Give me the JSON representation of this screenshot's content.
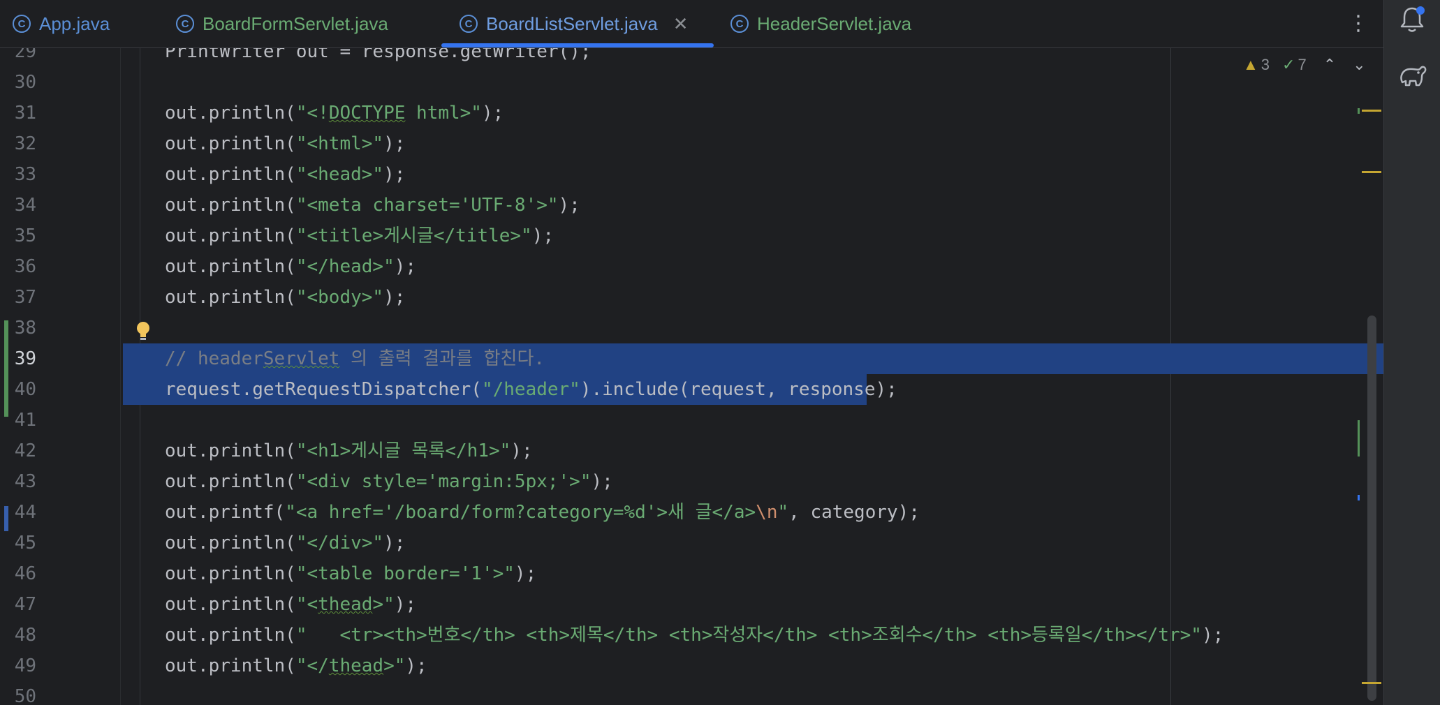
{
  "tabs": [
    {
      "label": "App.java",
      "icon": "class-c-icon"
    },
    {
      "label": "BoardFormServlet.java",
      "icon": "class-c-icon"
    },
    {
      "label": "BoardListServlet.java",
      "icon": "class-c-icon",
      "active": true
    },
    {
      "label": "HeaderServlet.java",
      "icon": "class-c-icon"
    }
  ],
  "inspection": {
    "warnings": "3",
    "checks": "7"
  },
  "colors": {
    "editor_bg": "#1e1f22",
    "selection": "#214283",
    "string": "#6aab73",
    "keyword_escape": "#cf8e6d",
    "comment": "#7a7e85",
    "accent": "#3574f0"
  },
  "lines": [
    {
      "n": "29",
      "tokens": [
        {
          "t": "PrintWriter out = response.getWriter();"
        }
      ]
    },
    {
      "n": "30",
      "tokens": []
    },
    {
      "n": "31",
      "tokens": [
        {
          "t": "out.println("
        },
        {
          "t": "\"<!",
          "c": "str"
        },
        {
          "t": "DOCTYPE",
          "c": "str wavy"
        },
        {
          "t": " html>\"",
          "c": "str"
        },
        {
          "t": ");"
        }
      ]
    },
    {
      "n": "32",
      "tokens": [
        {
          "t": "out.println("
        },
        {
          "t": "\"<html>\"",
          "c": "str"
        },
        {
          "t": ");"
        }
      ]
    },
    {
      "n": "33",
      "tokens": [
        {
          "t": "out.println("
        },
        {
          "t": "\"<head>\"",
          "c": "str"
        },
        {
          "t": ");"
        }
      ]
    },
    {
      "n": "34",
      "tokens": [
        {
          "t": "out.println("
        },
        {
          "t": "\"<meta charset='UTF-8'>\"",
          "c": "str"
        },
        {
          "t": ");"
        }
      ]
    },
    {
      "n": "35",
      "tokens": [
        {
          "t": "out.println("
        },
        {
          "t": "\"<title>게시글</title>\"",
          "c": "str"
        },
        {
          "t": ");"
        }
      ]
    },
    {
      "n": "36",
      "tokens": [
        {
          "t": "out.println("
        },
        {
          "t": "\"</head>\"",
          "c": "str"
        },
        {
          "t": ");"
        }
      ]
    },
    {
      "n": "37",
      "tokens": [
        {
          "t": "out.println("
        },
        {
          "t": "\"<body>\"",
          "c": "str"
        },
        {
          "t": ");"
        }
      ]
    },
    {
      "n": "38",
      "tokens": []
    },
    {
      "n": "39",
      "tokens": [
        {
          "t": "// header",
          "c": "cmt"
        },
        {
          "t": "Servlet",
          "c": "cmt wavy"
        },
        {
          "t": " 의 출력 결과를 합친다.",
          "c": "cmt"
        }
      ]
    },
    {
      "n": "40",
      "tokens": [
        {
          "t": "request.getRequestDispatcher("
        },
        {
          "t": "\"/header\"",
          "c": "str"
        },
        {
          "t": ").include(request, response);"
        }
      ]
    },
    {
      "n": "41",
      "tokens": []
    },
    {
      "n": "42",
      "tokens": [
        {
          "t": "out.println("
        },
        {
          "t": "\"<h1>게시글 목록</h1>\"",
          "c": "str"
        },
        {
          "t": ");"
        }
      ]
    },
    {
      "n": "43",
      "tokens": [
        {
          "t": "out.println("
        },
        {
          "t": "\"<div style='margin:5px;'>\"",
          "c": "str"
        },
        {
          "t": ");"
        }
      ]
    },
    {
      "n": "44",
      "tokens": [
        {
          "t": "out.printf("
        },
        {
          "t": "\"<a href='/board/form?category=%d'>새 글</a>",
          "c": "str"
        },
        {
          "t": "\\n",
          "c": "esc"
        },
        {
          "t": "\"",
          "c": "str"
        },
        {
          "t": ", category);"
        }
      ]
    },
    {
      "n": "45",
      "tokens": [
        {
          "t": "out.println("
        },
        {
          "t": "\"</div>\"",
          "c": "str"
        },
        {
          "t": ");"
        }
      ]
    },
    {
      "n": "46",
      "tokens": [
        {
          "t": "out.println("
        },
        {
          "t": "\"<table border='1'>\"",
          "c": "str"
        },
        {
          "t": ");"
        }
      ]
    },
    {
      "n": "47",
      "tokens": [
        {
          "t": "out.println("
        },
        {
          "t": "\"<",
          "c": "str"
        },
        {
          "t": "thead",
          "c": "str wavy"
        },
        {
          "t": ">\"",
          "c": "str"
        },
        {
          "t": ");"
        }
      ]
    },
    {
      "n": "48",
      "tokens": [
        {
          "t": "out.println("
        },
        {
          "t": "\"   <tr><th>번호</th> <th>제목</th> <th>작성자</th> <th>조회수</th> <th>등록일</th></tr>\"",
          "c": "str"
        },
        {
          "t": ");"
        }
      ]
    },
    {
      "n": "49",
      "tokens": [
        {
          "t": "out.println("
        },
        {
          "t": "\"</",
          "c": "str"
        },
        {
          "t": "thead",
          "c": "str wavy"
        },
        {
          "t": ">\"",
          "c": "str"
        },
        {
          "t": ");"
        }
      ]
    },
    {
      "n": "50",
      "tokens": []
    }
  ]
}
